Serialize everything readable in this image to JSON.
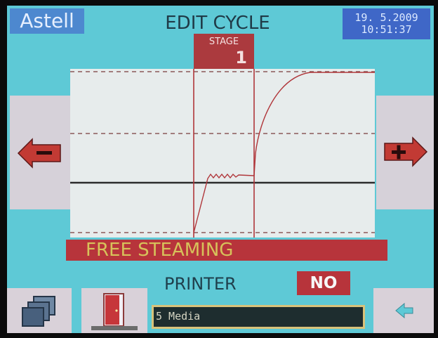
{
  "header": {
    "logo": "Astell",
    "title": "EDIT CYCLE",
    "date": "19. 5.2009",
    "time": "10:51:37"
  },
  "stage": {
    "label": "STAGE",
    "number": "1"
  },
  "navigation": {
    "prev_icon": "minus-arrow-icon",
    "next_icon": "plus-arrow-icon"
  },
  "status": {
    "text": "FREE STEAMING"
  },
  "printer": {
    "label": "PRINTER",
    "value": "NO"
  },
  "bottom": {
    "media_text": "5 Media",
    "icons": [
      "copy-icon",
      "door-icon",
      "back-arrow-icon"
    ]
  },
  "colors": {
    "screen": "#5ec9d6",
    "accent_red": "#b7343b",
    "graph_bg": "#e7ecec",
    "curve": "#b0363a"
  }
}
